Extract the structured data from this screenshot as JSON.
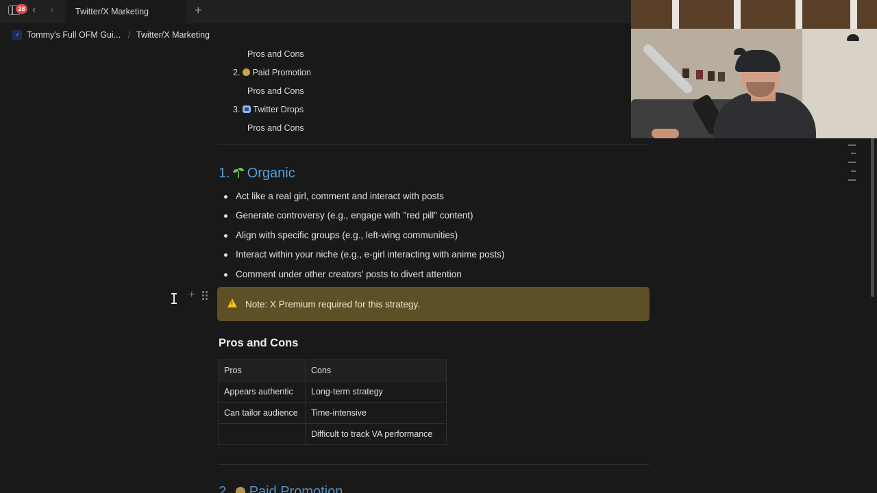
{
  "tabbar": {
    "badge_count": "28",
    "back_glyph": "‹",
    "forward_glyph": "›",
    "active_tab": "Twitter/X Marketing",
    "add_glyph": "+"
  },
  "breadcrumb": {
    "icon": "notion-page-icon",
    "items": [
      "Tommy's Full OFM Gui...",
      "Twitter/X Marketing"
    ],
    "separator": "/"
  },
  "toc": {
    "item1_sub": "Pros and Cons",
    "item2_num": "2.",
    "item2_label": "Paid Promotion",
    "item2_sub": "Pros and Cons",
    "item3_num": "3.",
    "item3_label": "Twitter Drops",
    "item3_sub": "Pros and Cons",
    "item2_icon": "money-bag-icon",
    "item3_icon": "twitter-drops-icon"
  },
  "section_organic": {
    "number": "1.",
    "title": "Organic",
    "icon": "seedling-icon",
    "bullets": [
      "Act like a real girl, comment and interact with posts",
      "Generate controversy (e.g., engage with \"red pill\" content)",
      "Align with specific groups (e.g., left-wing communities)",
      "Interact within your niche (e.g., e-girl interacting with anime posts)",
      "Comment under other creators' posts to divert attention"
    ]
  },
  "callout": {
    "icon": "warning-icon",
    "text": "Note: X Premium required for this strategy.",
    "background": "#5d5026"
  },
  "pros_cons": {
    "heading": "Pros and Cons",
    "headers": [
      "Pros",
      "Cons"
    ],
    "rows": [
      [
        "Appears authentic",
        "Long-term strategy"
      ],
      [
        "Can tailor audience",
        "Time-intensive"
      ],
      [
        "",
        "Difficult to track VA performance"
      ]
    ]
  },
  "next_section": {
    "number": "2.",
    "title": "Paid Promotion"
  },
  "colors": {
    "heading_blue": "#5a9fd6",
    "background": "#191919"
  }
}
